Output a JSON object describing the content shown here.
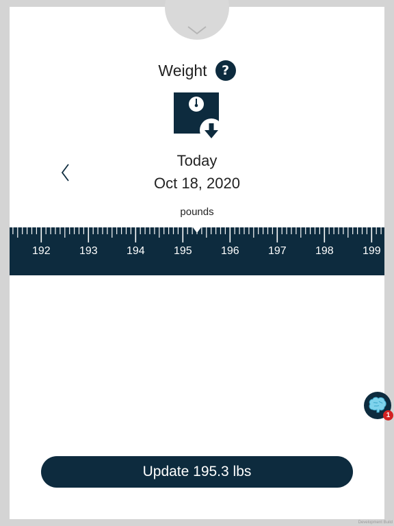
{
  "header": {
    "title": "Weight",
    "help_label": "?"
  },
  "icons": {
    "collapse": "chevron-down-icon",
    "help": "question-icon",
    "scale": "scale-import-icon",
    "previous": "chevron-left-icon",
    "assistant": "brain-icon"
  },
  "date": {
    "relative": "Today",
    "full": "Oct 18, 2020"
  },
  "ruler": {
    "unit_label": "pounds",
    "selected_value": 195.3,
    "labels": [
      "192",
      "193",
      "194",
      "195",
      "196",
      "197",
      "198",
      "199"
    ]
  },
  "action": {
    "update_label": "Update 195.3 lbs"
  },
  "assistant": {
    "badge_count": "1"
  },
  "watermark": "Development Build",
  "colors": {
    "primary": "#0d2b3e",
    "background": "#ffffff",
    "frame": "#d4d4d4",
    "badge": "#d32222"
  }
}
